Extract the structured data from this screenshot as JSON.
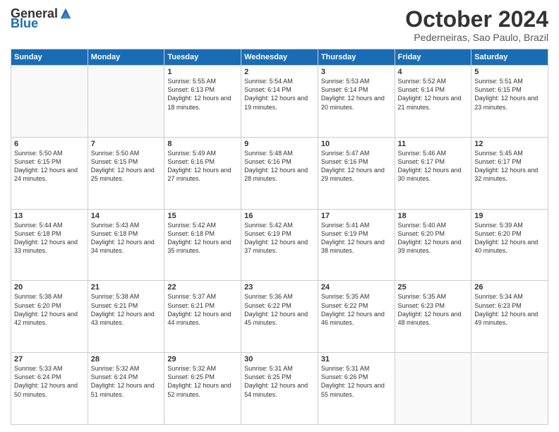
{
  "logo": {
    "general": "General",
    "blue": "Blue"
  },
  "title": "October 2024",
  "location": "Pederneiras, Sao Paulo, Brazil",
  "days_of_week": [
    "Sunday",
    "Monday",
    "Tuesday",
    "Wednesday",
    "Thursday",
    "Friday",
    "Saturday"
  ],
  "weeks": [
    [
      {
        "day": "",
        "info": ""
      },
      {
        "day": "",
        "info": ""
      },
      {
        "day": "1",
        "info": "Sunrise: 5:55 AM\nSunset: 6:13 PM\nDaylight: 12 hours and 18 minutes."
      },
      {
        "day": "2",
        "info": "Sunrise: 5:54 AM\nSunset: 6:14 PM\nDaylight: 12 hours and 19 minutes."
      },
      {
        "day": "3",
        "info": "Sunrise: 5:53 AM\nSunset: 6:14 PM\nDaylight: 12 hours and 20 minutes."
      },
      {
        "day": "4",
        "info": "Sunrise: 5:52 AM\nSunset: 6:14 PM\nDaylight: 12 hours and 21 minutes."
      },
      {
        "day": "5",
        "info": "Sunrise: 5:51 AM\nSunset: 6:15 PM\nDaylight: 12 hours and 23 minutes."
      }
    ],
    [
      {
        "day": "6",
        "info": "Sunrise: 5:50 AM\nSunset: 6:15 PM\nDaylight: 12 hours and 24 minutes."
      },
      {
        "day": "7",
        "info": "Sunrise: 5:50 AM\nSunset: 6:15 PM\nDaylight: 12 hours and 25 minutes."
      },
      {
        "day": "8",
        "info": "Sunrise: 5:49 AM\nSunset: 6:16 PM\nDaylight: 12 hours and 27 minutes."
      },
      {
        "day": "9",
        "info": "Sunrise: 5:48 AM\nSunset: 6:16 PM\nDaylight: 12 hours and 28 minutes."
      },
      {
        "day": "10",
        "info": "Sunrise: 5:47 AM\nSunset: 6:16 PM\nDaylight: 12 hours and 29 minutes."
      },
      {
        "day": "11",
        "info": "Sunrise: 5:46 AM\nSunset: 6:17 PM\nDaylight: 12 hours and 30 minutes."
      },
      {
        "day": "12",
        "info": "Sunrise: 5:45 AM\nSunset: 6:17 PM\nDaylight: 12 hours and 32 minutes."
      }
    ],
    [
      {
        "day": "13",
        "info": "Sunrise: 5:44 AM\nSunset: 6:18 PM\nDaylight: 12 hours and 33 minutes."
      },
      {
        "day": "14",
        "info": "Sunrise: 5:43 AM\nSunset: 6:18 PM\nDaylight: 12 hours and 34 minutes."
      },
      {
        "day": "15",
        "info": "Sunrise: 5:42 AM\nSunset: 6:18 PM\nDaylight: 12 hours and 35 minutes."
      },
      {
        "day": "16",
        "info": "Sunrise: 5:42 AM\nSunset: 6:19 PM\nDaylight: 12 hours and 37 minutes."
      },
      {
        "day": "17",
        "info": "Sunrise: 5:41 AM\nSunset: 6:19 PM\nDaylight: 12 hours and 38 minutes."
      },
      {
        "day": "18",
        "info": "Sunrise: 5:40 AM\nSunset: 6:20 PM\nDaylight: 12 hours and 39 minutes."
      },
      {
        "day": "19",
        "info": "Sunrise: 5:39 AM\nSunset: 6:20 PM\nDaylight: 12 hours and 40 minutes."
      }
    ],
    [
      {
        "day": "20",
        "info": "Sunrise: 5:38 AM\nSunset: 6:20 PM\nDaylight: 12 hours and 42 minutes."
      },
      {
        "day": "21",
        "info": "Sunrise: 5:38 AM\nSunset: 6:21 PM\nDaylight: 12 hours and 43 minutes."
      },
      {
        "day": "22",
        "info": "Sunrise: 5:37 AM\nSunset: 6:21 PM\nDaylight: 12 hours and 44 minutes."
      },
      {
        "day": "23",
        "info": "Sunrise: 5:36 AM\nSunset: 6:22 PM\nDaylight: 12 hours and 45 minutes."
      },
      {
        "day": "24",
        "info": "Sunrise: 5:35 AM\nSunset: 6:22 PM\nDaylight: 12 hours and 46 minutes."
      },
      {
        "day": "25",
        "info": "Sunrise: 5:35 AM\nSunset: 6:23 PM\nDaylight: 12 hours and 48 minutes."
      },
      {
        "day": "26",
        "info": "Sunrise: 5:34 AM\nSunset: 6:23 PM\nDaylight: 12 hours and 49 minutes."
      }
    ],
    [
      {
        "day": "27",
        "info": "Sunrise: 5:33 AM\nSunset: 6:24 PM\nDaylight: 12 hours and 50 minutes."
      },
      {
        "day": "28",
        "info": "Sunrise: 5:32 AM\nSunset: 6:24 PM\nDaylight: 12 hours and 51 minutes."
      },
      {
        "day": "29",
        "info": "Sunrise: 5:32 AM\nSunset: 6:25 PM\nDaylight: 12 hours and 52 minutes."
      },
      {
        "day": "30",
        "info": "Sunrise: 5:31 AM\nSunset: 6:25 PM\nDaylight: 12 hours and 54 minutes."
      },
      {
        "day": "31",
        "info": "Sunrise: 5:31 AM\nSunset: 6:26 PM\nDaylight: 12 hours and 55 minutes."
      },
      {
        "day": "",
        "info": ""
      },
      {
        "day": "",
        "info": ""
      }
    ]
  ]
}
